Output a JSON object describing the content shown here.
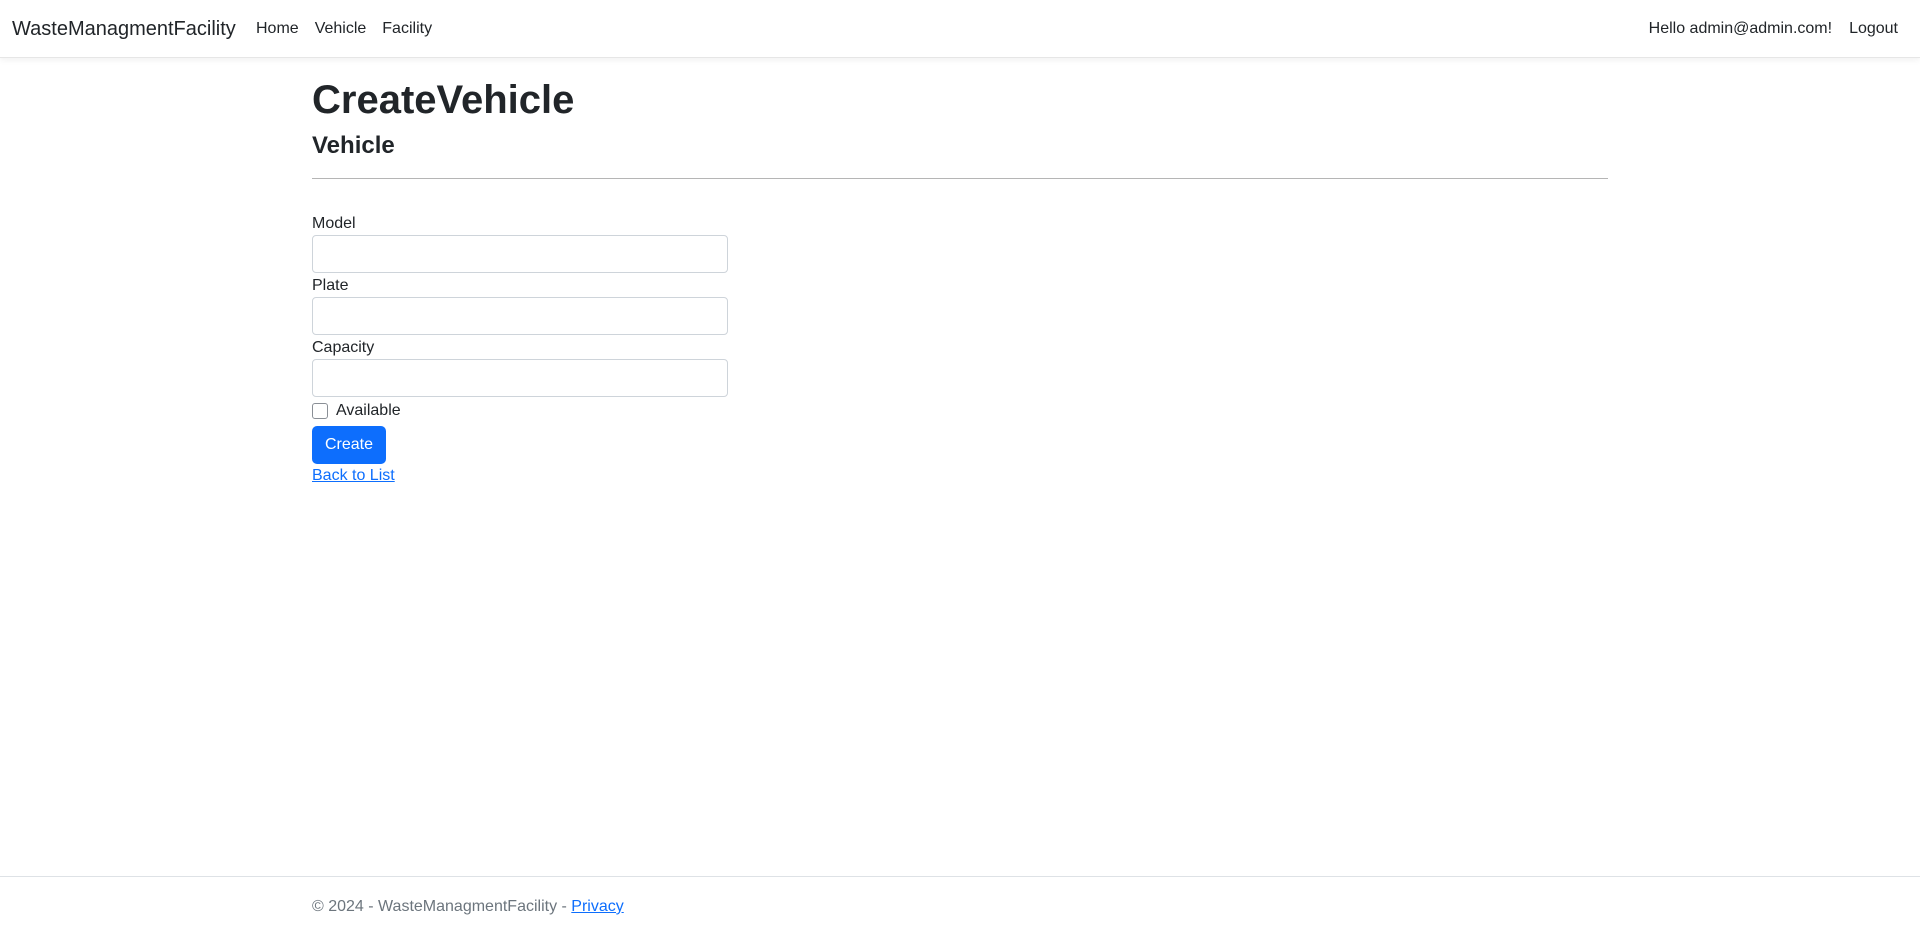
{
  "navbar": {
    "brand": "WasteManagmentFacility",
    "links": [
      {
        "label": "Home"
      },
      {
        "label": "Vehicle"
      },
      {
        "label": "Facility"
      }
    ],
    "greeting": "Hello admin@admin.com!",
    "logout_label": "Logout"
  },
  "page": {
    "title": "CreateVehicle",
    "subtitle": "Vehicle"
  },
  "form": {
    "model_label": "Model",
    "model_value": "",
    "plate_label": "Plate",
    "plate_value": "",
    "capacity_label": "Capacity",
    "capacity_value": "",
    "available_label": "Available",
    "available_checked": false,
    "create_button": "Create",
    "back_link": "Back to List"
  },
  "footer": {
    "text": "© 2024 - WasteManagmentFacility - ",
    "privacy_link": "Privacy"
  },
  "colors": {
    "primary": "#0d6efd",
    "text": "#212529",
    "muted": "#6c757d"
  }
}
